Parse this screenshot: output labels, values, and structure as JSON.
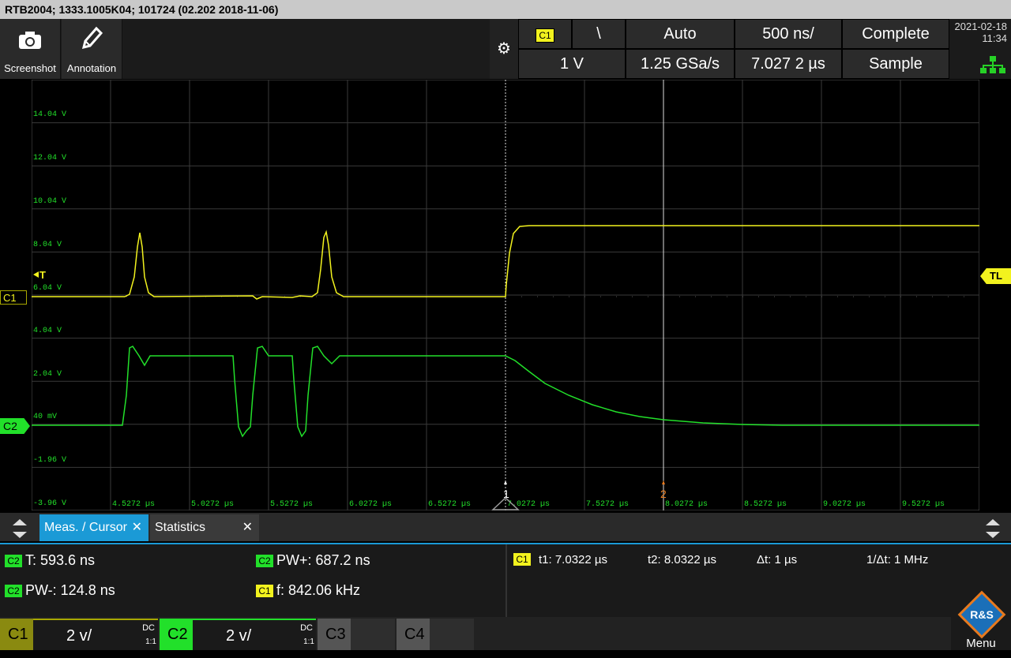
{
  "title": "RTB2004; 1333.1005K04; 101724 (02.202 2018-11-06)",
  "toolbar": {
    "screenshot_label": "Screenshot",
    "annotation_label": "Annotation"
  },
  "trigger_panel": {
    "source": "C1",
    "slope": "\\",
    "mode": "Auto",
    "timebase": "500 ns/",
    "acq_status": "Complete",
    "level": "1 V",
    "sample_rate": "1.25 GSa/s",
    "position": "7.027 2 µs",
    "acq_mode": "Sample"
  },
  "datetime": {
    "date": "2021-02-18",
    "time": "11:34"
  },
  "grid": {
    "y_labels": [
      "14.04 V",
      "12.04 V",
      "10.04 V",
      "8.04 V",
      "6.04 V",
      "4.04 V",
      "2.04 V",
      "40 mV",
      "-1.96 V",
      "-3.96 V"
    ],
    "x_labels": [
      "4.5272 µs",
      "5.0272 µs",
      "5.5272 µs",
      "6.0272 µs",
      "6.5272 µs",
      "7.0272 µs",
      "7.5272 µs",
      "8.0272 µs",
      "8.5272 µs",
      "9.0272 µs",
      "9.5272 µs"
    ],
    "c1_marker": "C1",
    "c2_marker": "C2",
    "trigger_marker": "T",
    "trigger_level_marker": "TL",
    "cursor1_label": "1",
    "cursor2_label": "2"
  },
  "tabs": {
    "meas_cursor": "Meas. / Cursor",
    "statistics": "Statistics"
  },
  "measurements": {
    "t": {
      "source": "C2",
      "text": "T: 593.6 ns"
    },
    "pw_pos": {
      "source": "C2",
      "text": "PW+: 687.2 ns"
    },
    "pw_neg": {
      "source": "C2",
      "text": "PW-: 124.8 ns"
    },
    "freq": {
      "source": "C1",
      "text": "f: 842.06 kHz"
    },
    "cursor_source": "C1",
    "t1": "t1: 7.0322 µs",
    "t2": "t2: 8.0322 µs",
    "dt": "Δt: 1 µs",
    "inv_dt": "1/Δt: 1 MHz"
  },
  "channels": [
    {
      "name": "C1",
      "scale": "2 v/",
      "coupling": "DC",
      "probe": "1:1"
    },
    {
      "name": "C2",
      "scale": "2 v/",
      "coupling": "DC",
      "probe": "1:1"
    },
    {
      "name": "C3"
    },
    {
      "name": "C4"
    }
  ],
  "menu_label": "Menu",
  "colors": {
    "c1": "#f2f21e",
    "c2": "#22e02a",
    "accent": "#1b9ad6",
    "cursor2": "#e87a1e"
  }
}
